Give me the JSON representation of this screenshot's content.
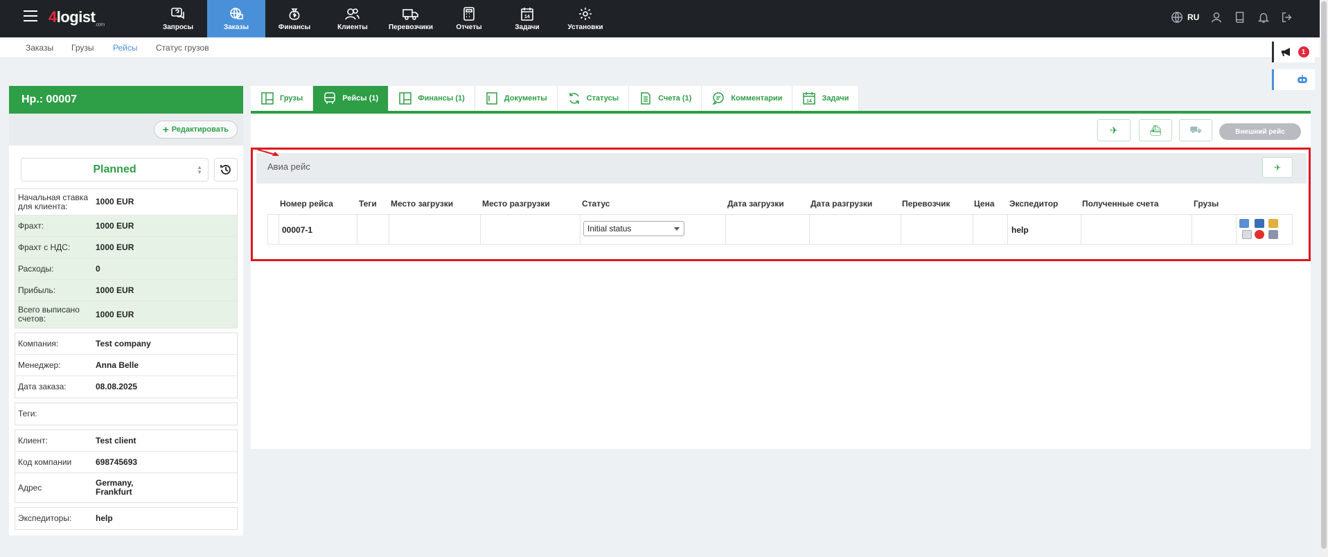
{
  "app": {
    "logo_brand": "logist",
    "logo_four": "4",
    "logo_suffix": ".com",
    "lang": "RU"
  },
  "nav": [
    {
      "label": "Запросы",
      "icon": "question-chat-icon"
    },
    {
      "label": "Заказы",
      "icon": "globe-box-icon",
      "active": true
    },
    {
      "label": "Финансы",
      "icon": "money-bag-icon"
    },
    {
      "label": "Клиенты",
      "icon": "users-icon"
    },
    {
      "label": "Перевозчики",
      "icon": "truck-icon"
    },
    {
      "label": "Отчеты",
      "icon": "calculator-icon"
    },
    {
      "label": "Задачи",
      "icon": "calendar-icon"
    },
    {
      "label": "Установки",
      "icon": "gear-icon"
    }
  ],
  "subnav": [
    "Заказы",
    "Грузы",
    "Рейсы",
    "Статус грузов"
  ],
  "notifications": {
    "count": "1"
  },
  "order": {
    "title": "Нр.: 00007",
    "edit_label": "Редактировать",
    "status": "Planned",
    "finance": [
      {
        "k": "Начальная ставка для клиента:",
        "v": "1000 EUR"
      },
      {
        "k": "Фрахт:",
        "v": "1000 EUR"
      },
      {
        "k": "Фрахт с НДС:",
        "v": "1000 EUR"
      },
      {
        "k": "Расходы:",
        "v": "0"
      },
      {
        "k": "Прибыль:",
        "v": "1000 EUR"
      },
      {
        "k": "Всего выписано счетов:",
        "v": "1000 EUR"
      }
    ],
    "company": [
      {
        "k": "Компания:",
        "v": "Test company"
      },
      {
        "k": "Менеджер:",
        "v": "Anna Belle"
      },
      {
        "k": "Дата заказа:",
        "v": "08.08.2025"
      }
    ],
    "tags": {
      "k": "Теги:",
      "v": ""
    },
    "client": [
      {
        "k": "Клиент:",
        "v": "Test client"
      },
      {
        "k": "Код компании",
        "v": "698745693"
      },
      {
        "k": "Адрес",
        "v": "Germany, Frankfurt"
      }
    ],
    "forwarders": {
      "k": "Экспедиторы:",
      "v": "help"
    }
  },
  "tabs": [
    "Грузы",
    "Рейсы (1)",
    "Финансы (1)",
    "Документы",
    "Статусы",
    "Счета (1)",
    "Комментарии",
    "Задачи"
  ],
  "external_trip_label": "Внешний рейс",
  "air": {
    "title": "Авиа рейс",
    "columns": [
      "Номер рейса",
      "Теги",
      "Место загрузки",
      "Место разгрузки",
      "Статус",
      "Дата загрузки",
      "Дата разгрузки",
      "Перевозчик",
      "Цена",
      "Экспедитор",
      "Полученные счета",
      "Грузы"
    ],
    "row": {
      "number": "00007-1",
      "status": "Initial status",
      "forwarder": "help"
    }
  }
}
